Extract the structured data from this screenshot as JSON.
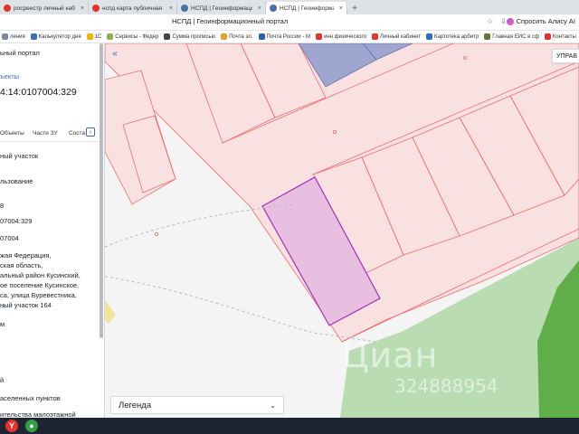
{
  "browser": {
    "tabs": [
      {
        "label": "росреестр личный кабин",
        "favicon_color": "#e5322d",
        "active": false
      },
      {
        "label": "нспд карта публичная ка",
        "favicon_color": "#e5322d",
        "active": false
      },
      {
        "label": "НСПД | Геоинформаци",
        "favicon_color": "#4a6fa5",
        "active": false
      },
      {
        "label": "НСПД | Геоинформаци",
        "favicon_color": "#4a6fa5",
        "active": true
      }
    ],
    "close_glyph": "×",
    "new_tab_glyph": "+",
    "page_title": "НСПД | Геоинформационный портал",
    "alice_label": "Спросить Алису AI",
    "bookmarks": [
      {
        "label": "ления",
        "icon_color": "#7a8aa0"
      },
      {
        "label": "Калькулятор дня",
        "icon_color": "#3f6fb5"
      },
      {
        "label": "1С",
        "icon_color": "#f2b600"
      },
      {
        "label": "Сервисы - Федер",
        "icon_color": "#8bb34a"
      },
      {
        "label": "Сумма прописью",
        "icon_color": "#444"
      },
      {
        "label": "Почта эл.",
        "icon_color": "#e3a32a"
      },
      {
        "label": "Почта России - М",
        "icon_color": "#2b5fb3"
      },
      {
        "label": "инн физического",
        "icon_color": "#e5322d"
      },
      {
        "label": "Личный кабинет",
        "icon_color": "#e5322d"
      },
      {
        "label": "Картотека арбитр",
        "icon_color": "#2b6cc4"
      },
      {
        "label": "Главная ЕИС в сф",
        "icon_color": "#5a7d2f"
      },
      {
        "label": "Контакты",
        "icon_color": "#e5322d"
      }
    ]
  },
  "left_panel": {
    "portal_label": "ьный портал",
    "objects_link": "ъекты",
    "cad_number": "4:14:0107004:329",
    "tabs": [
      "Объекты",
      "Части ЗУ",
      "Соста"
    ],
    "tab_arrow": "›",
    "lines": [
      "ный участок",
      "льзование",
      "8",
      "07004:329",
      "07004",
      "жая Федерация,",
      "ская область,",
      "альный район Кусинский,",
      "ое поселение Кусинское,",
      "са, улица Буревестника,",
      "ный участок 164",
      "м",
      "й",
      "аселенных пунктов",
      "ительства малоэтажной"
    ],
    "caret_glyph": "^"
  },
  "map": {
    "collapse_glyph": "«",
    "manage_label": "УПРАВ",
    "legend_label": "Легенда",
    "legend_chevron": "⌄",
    "watermark_text": "Циан",
    "watermark_phone": "324888954",
    "colors": {
      "parcel_fill": "#f9e1e2",
      "parcel_stroke": "#ef6b6b",
      "selected_fill": "#e8bfe0",
      "selected_stroke": "#a32fb5",
      "blue_fill": "#9ea6cf",
      "green_light": "#b9dcb3",
      "green_dark": "#5fae4a",
      "road": "#f2f2f2"
    }
  },
  "taskbar": {
    "icons": [
      {
        "name": "yandex-browser-icon",
        "glyph": "Y",
        "color": "#e5322d"
      },
      {
        "name": "chrome-icon",
        "glyph": "●",
        "color": "#2f9e44"
      }
    ]
  }
}
